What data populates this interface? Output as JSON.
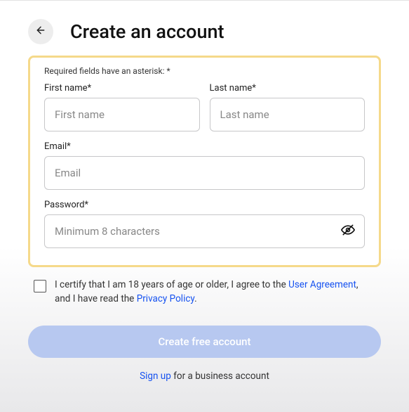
{
  "header": {
    "title": "Create an account"
  },
  "form": {
    "required_note": "Required fields have an asterisk: *",
    "first_name": {
      "label": "First name*",
      "placeholder": "First name",
      "value": ""
    },
    "last_name": {
      "label": "Last name*",
      "placeholder": "Last name",
      "value": ""
    },
    "email": {
      "label": "Email*",
      "placeholder": "Email",
      "value": ""
    },
    "password": {
      "label": "Password*",
      "placeholder": "Minimum 8 characters",
      "value": ""
    }
  },
  "certify": {
    "text_before": "I certify that I am 18 years of age or older, I agree to the ",
    "user_agreement": "User Agreement",
    "text_mid": ", and I have read the ",
    "privacy_policy": "Privacy Policy",
    "text_after": "."
  },
  "submit": {
    "label": "Create free account"
  },
  "business": {
    "link_text": "Sign up",
    "rest": " for a business account"
  }
}
